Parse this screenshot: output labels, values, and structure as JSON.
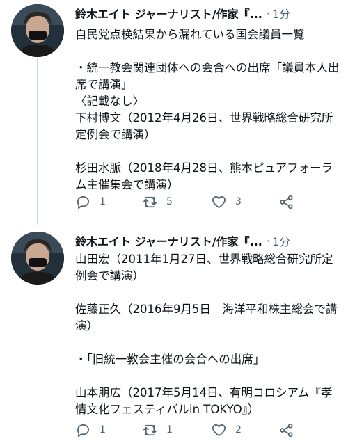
{
  "tweets": [
    {
      "author": "鈴木エイト ジャーナリスト/作家『...",
      "separator": "·",
      "time": "1分",
      "text": "自民党点検結果から漏れている国会議員一覧\n\n・統一教会関連団体への会合への出席「議員本人出席で講演」\n〈記載なし〉\n下村博文（2012年4月26日、世界戦略総合研究所定例会で講演）\n\n杉田水脈（2018年4月28日、熊本ピュアフォーラム主催集会で講演）",
      "reply_count": "1",
      "retweet_count": "5",
      "like_count": "3"
    },
    {
      "author": "鈴木エイト ジャーナリスト/作家『...",
      "separator": "·",
      "time": "1分",
      "text": "山田宏（2011年1月27日、世界戦略総合研究所定例会で講演）\n\n佐藤正久（2016年9月5日　海洋平和株主総会で講演）\n\n・「旧統一教会主催の会合への出席」\n\n山本朋広（2017年5月14日、有明コロシアム『孝情文化フェスティバルin TOKYO』）",
      "reply_count": "1",
      "retweet_count": "1",
      "like_count": "2"
    }
  ]
}
